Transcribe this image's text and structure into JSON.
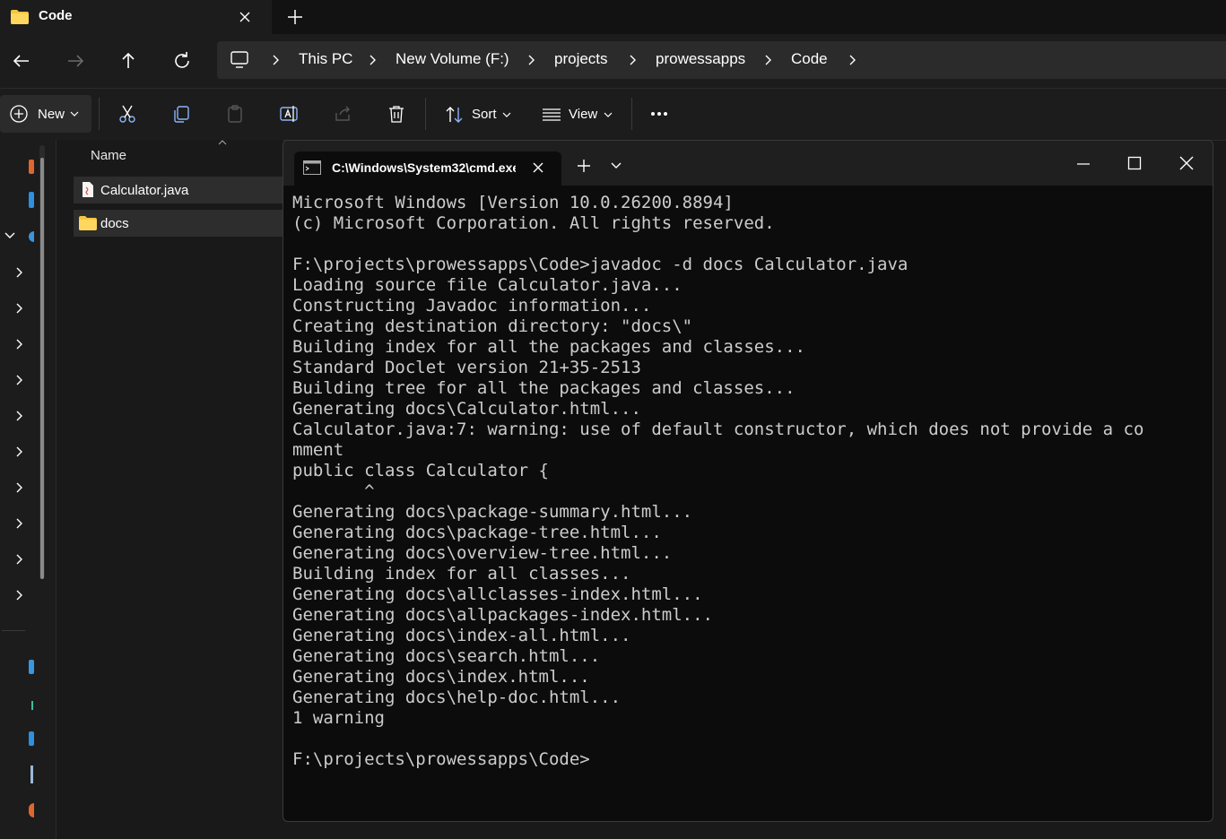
{
  "explorer": {
    "tab_title": "Code",
    "breadcrumb": [
      "This PC",
      "New Volume (F:)",
      "projects",
      "prowessapps",
      "Code"
    ],
    "commands": {
      "new_label": "New",
      "sort_label": "Sort",
      "view_label": "View"
    },
    "column_header": "Name",
    "files": [
      {
        "name": "Calculator.java",
        "icon": "java-file-icon"
      },
      {
        "name": "docs",
        "icon": "folder-icon"
      }
    ],
    "nav_icons": [
      "folder-icon",
      "folder-icon",
      "cloud-icon",
      "chevron-right-icon"
    ]
  },
  "terminal": {
    "tab_title": "C:\\Windows\\System32\\cmd.exe",
    "lines": [
      "Microsoft Windows [Version 10.0.26200.8894]",
      "(c) Microsoft Corporation. All rights reserved.",
      "",
      "F:\\projects\\prowessapps\\Code>javadoc -d docs Calculator.java",
      "Loading source file Calculator.java...",
      "Constructing Javadoc information...",
      "Creating destination directory: \"docs\\\"",
      "Building index for all the packages and classes...",
      "Standard Doclet version 21+35-2513",
      "Building tree for all the packages and classes...",
      "Generating docs\\Calculator.html...",
      "Calculator.java:7: warning: use of default constructor, which does not provide a co",
      "mment",
      "public class Calculator {",
      "       ^",
      "Generating docs\\package-summary.html...",
      "Generating docs\\package-tree.html...",
      "Generating docs\\overview-tree.html...",
      "Building index for all classes...",
      "Generating docs\\allclasses-index.html...",
      "Generating docs\\allpackages-index.html...",
      "Generating docs\\index-all.html...",
      "Generating docs\\search.html...",
      "Generating docs\\index.html...",
      "Generating docs\\help-doc.html...",
      "1 warning",
      "",
      "F:\\projects\\prowessapps\\Code>"
    ]
  },
  "colors": {
    "explorer_bg": "#1c1c1c",
    "terminal_bg": "#0c0c0c",
    "terminal_text": "#cccccc",
    "folder_yellow": "#f4c542",
    "accent_blue": "#3a96dd"
  }
}
